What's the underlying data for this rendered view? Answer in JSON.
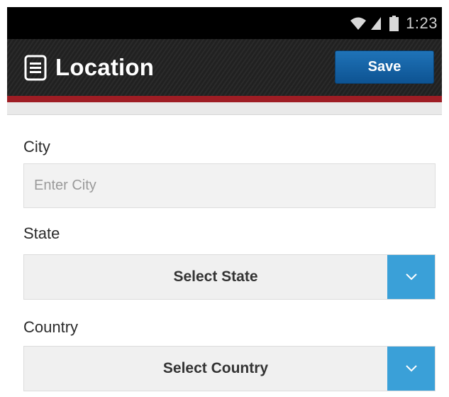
{
  "status_bar": {
    "time": "1:23",
    "icons": [
      "wifi-icon",
      "signal-icon",
      "battery-icon"
    ]
  },
  "action_bar": {
    "title": "Location",
    "menu_icon": "list-menu-icon",
    "save_label": "Save",
    "accent_color": "#9e1d24",
    "button_color": "#1565a8"
  },
  "form": {
    "city": {
      "label": "City",
      "value": "",
      "placeholder": "Enter City"
    },
    "state": {
      "label": "State",
      "selected": "Select State",
      "arrow_icon": "chevron-down-icon"
    },
    "country": {
      "label": "Country",
      "selected": "Select Country",
      "arrow_icon": "chevron-down-icon"
    }
  },
  "colors": {
    "select_arrow": "#3aa0d8"
  }
}
